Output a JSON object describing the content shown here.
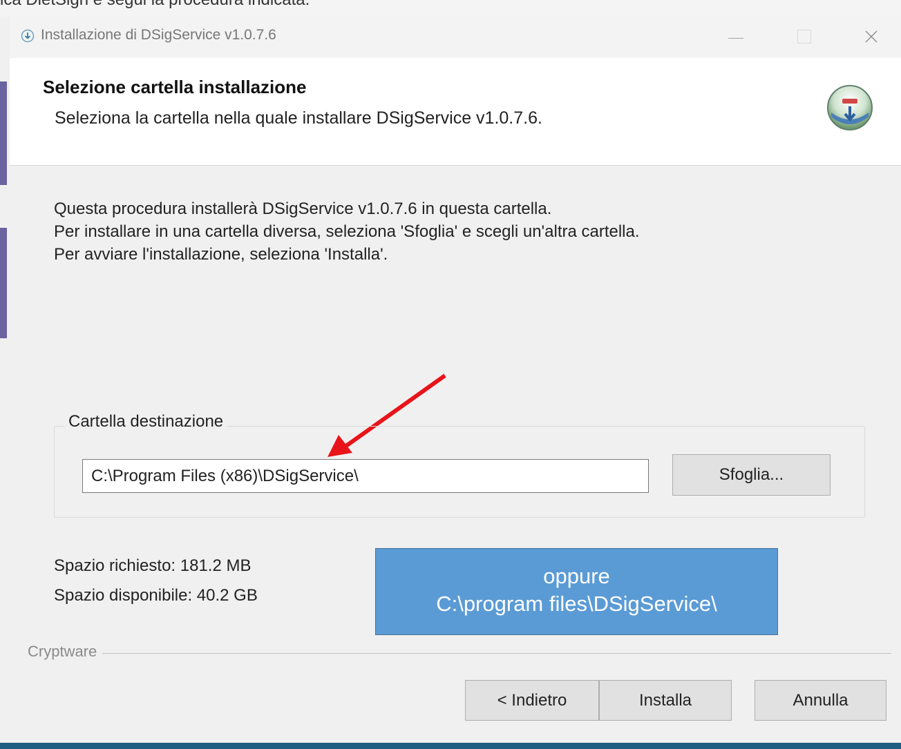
{
  "background": {
    "top_text": "ica DietSign e segui la procedura indicata."
  },
  "window": {
    "title": "Installazione di DSigService v1.0.7.6"
  },
  "header": {
    "title": "Selezione cartella installazione",
    "subtitle": "Seleziona la cartella nella quale installare DSigService v1.0.7.6."
  },
  "body": {
    "line1": "Questa procedura installerà DSigService v1.0.7.6 in questa cartella.",
    "line2": "Per installare in una cartella diversa, seleziona 'Sfoglia' e scegli un'altra cartella.",
    "line3": "Per avviare l'installazione, seleziona 'Installa'."
  },
  "destination": {
    "group_label": "Cartella destinazione",
    "path_value": "C:\\Program Files (x86)\\DSigService\\",
    "browse_label": "Sfoglia..."
  },
  "space": {
    "required": "Spazio richiesto: 181.2 MB",
    "available": "Spazio disponibile: 40.2 GB"
  },
  "annotation": {
    "line1": "oppure",
    "line2": "C:\\program files\\DSigService\\",
    "arrow_color": "#e8141a",
    "box_color": "#5b9bd5"
  },
  "footer": {
    "brand": "Cryptware",
    "back_label": "< Indietro",
    "install_label": "Installa",
    "cancel_label": "Annulla"
  }
}
